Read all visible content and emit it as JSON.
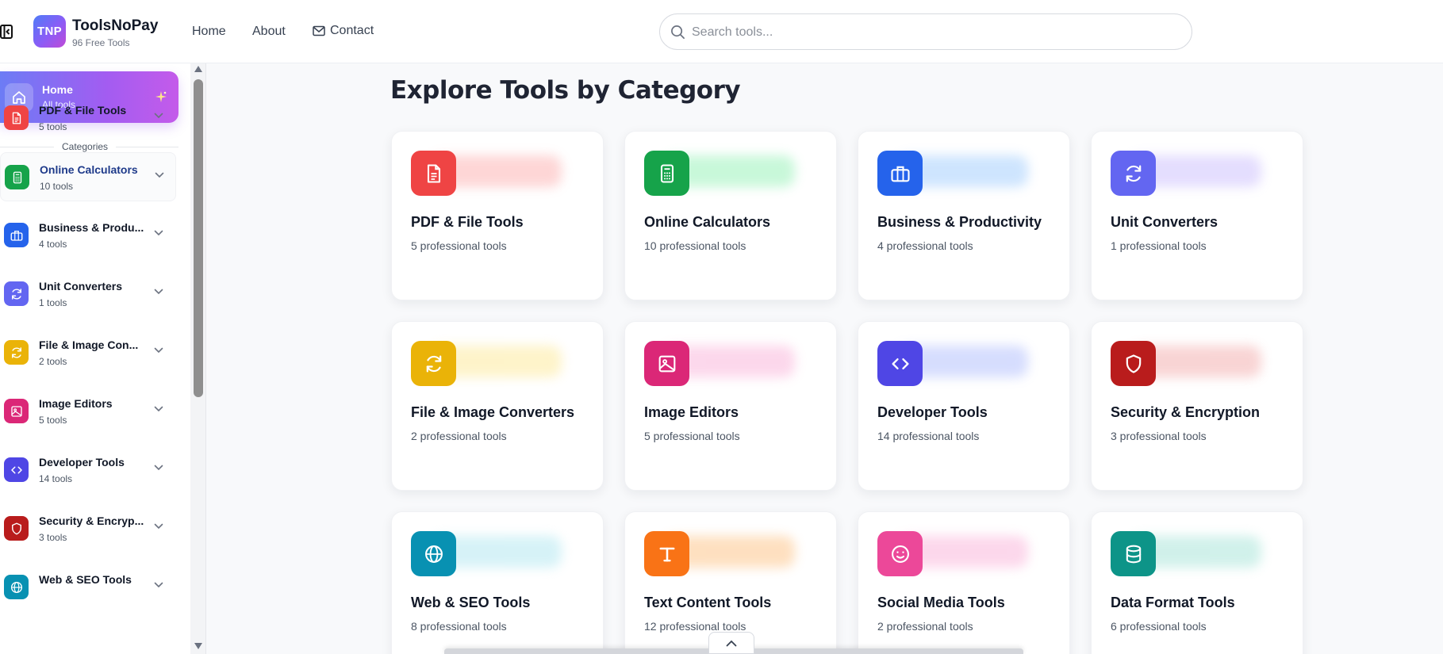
{
  "header": {
    "logo_text": "TNP",
    "brand_name": "ToolsNoPay",
    "brand_sub": "96 Free Tools",
    "nav": {
      "home": "Home",
      "about": "About",
      "contact": "Contact"
    },
    "search_placeholder": "Search tools..."
  },
  "sidebar": {
    "home": {
      "title": "Home",
      "subtitle": "All tools"
    },
    "categories_label": "Categories",
    "items": [
      {
        "name": "PDF & File Tools",
        "count": "5 tools",
        "color": "#ef4444",
        "icon": "file-icon"
      },
      {
        "name": "Online Calculators",
        "count": "10 tools",
        "color": "#16a34a",
        "icon": "calculator-icon",
        "active": true
      },
      {
        "name": "Business & Produ...",
        "count": "4 tools",
        "color": "#2563eb",
        "icon": "briefcase-icon"
      },
      {
        "name": "Unit Converters",
        "count": "1 tools",
        "color": "#6366f1",
        "icon": "refresh-icon"
      },
      {
        "name": "File & Image Con...",
        "count": "2 tools",
        "color": "#eab308",
        "icon": "refresh-icon"
      },
      {
        "name": "Image Editors",
        "count": "5 tools",
        "color": "#db2777",
        "icon": "image-icon"
      },
      {
        "name": "Developer Tools",
        "count": "14 tools",
        "color": "#4f46e5",
        "icon": "code-icon"
      },
      {
        "name": "Security & Encryp...",
        "count": "3 tools",
        "color": "#b91c1c",
        "icon": "shield-icon"
      },
      {
        "name": "Web & SEO Tools",
        "count": "",
        "color": "#0891b2",
        "icon": "globe-icon"
      }
    ]
  },
  "main": {
    "title": "Explore Tools by Category",
    "cards": [
      {
        "title": "PDF & File Tools",
        "count": "5 professional tools",
        "color": "#ef4444",
        "glow": "#fca5a5",
        "icon": "file-icon"
      },
      {
        "title": "Online Calculators",
        "count": "10 professional tools",
        "color": "#16a34a",
        "glow": "#86efac",
        "icon": "calculator-icon"
      },
      {
        "title": "Business & Productivity",
        "count": "4 professional tools",
        "color": "#2563eb",
        "glow": "#93c5fd",
        "icon": "briefcase-icon"
      },
      {
        "title": "Unit Converters",
        "count": "1 professional tools",
        "color": "#6366f1",
        "glow": "#c4b5fd",
        "icon": "refresh-icon"
      },
      {
        "title": "File & Image Converters",
        "count": "2 professional tools",
        "color": "#eab308",
        "glow": "#fde68a",
        "icon": "refresh-icon"
      },
      {
        "title": "Image Editors",
        "count": "5 professional tools",
        "color": "#db2777",
        "glow": "#f9a8d4",
        "icon": "image-icon"
      },
      {
        "title": "Developer Tools",
        "count": "14 professional tools",
        "color": "#4f46e5",
        "glow": "#a5b4fc",
        "icon": "code-icon"
      },
      {
        "title": "Security & Encryption",
        "count": "3 professional tools",
        "color": "#b91c1c",
        "glow": "#f1a1a1",
        "icon": "shield-icon"
      },
      {
        "title": "Web & SEO Tools",
        "count": "8 professional tools",
        "color": "#0891b2",
        "glow": "#a5e3ee",
        "icon": "globe-icon"
      },
      {
        "title": "Text Content Tools",
        "count": "12 professional tools",
        "color": "#f97316",
        "glow": "#fdba74",
        "icon": "text-icon"
      },
      {
        "title": "Social Media Tools",
        "count": "2 professional tools",
        "color": "#ec4899",
        "glow": "#f9a8d4",
        "icon": "smile-icon"
      },
      {
        "title": "Data Format Tools",
        "count": "6 professional tools",
        "color": "#0d9488",
        "glow": "#99e0d2",
        "icon": "database-icon"
      }
    ]
  }
}
